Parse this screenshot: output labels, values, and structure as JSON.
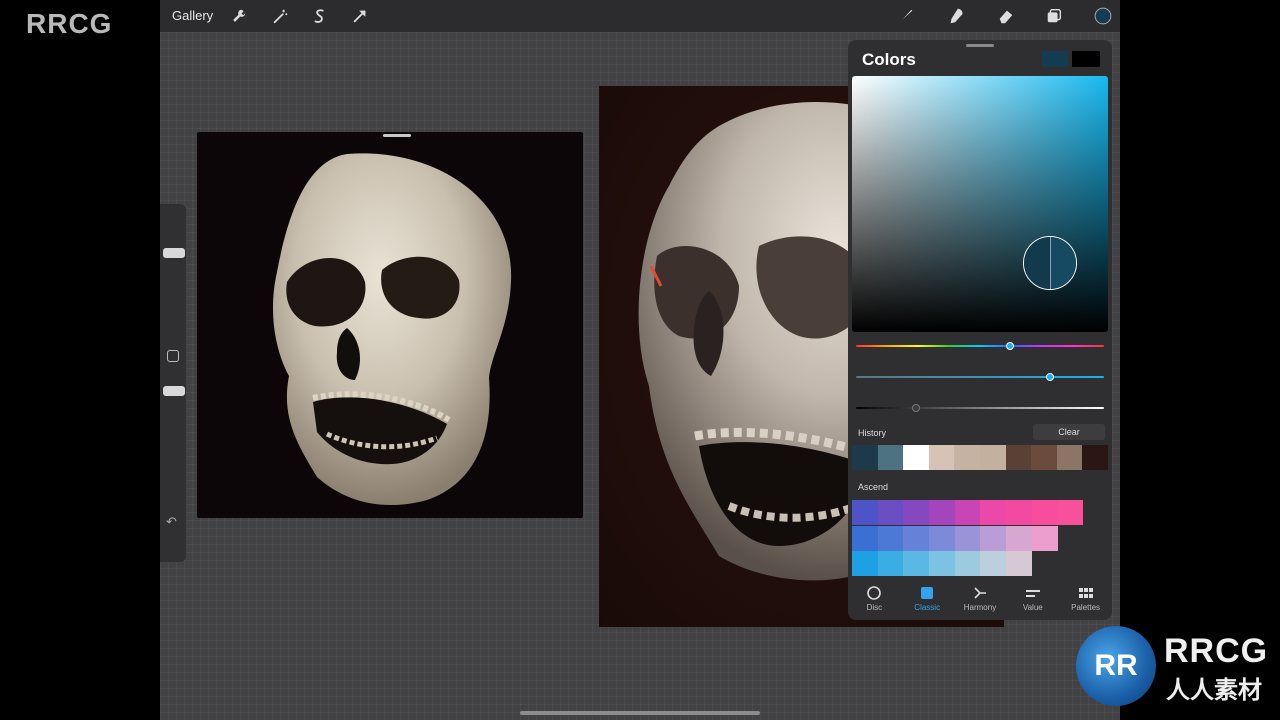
{
  "watermark": {
    "brand": "RRCG",
    "brand_cn": "人人素材"
  },
  "toolbar": {
    "gallery_label": "Gallery",
    "left_tools": [
      "wrench-icon",
      "magic-wand-icon",
      "selection-icon",
      "transform-icon"
    ],
    "right_tools": [
      "brush-icon",
      "smudge-icon",
      "eraser-icon",
      "layers-icon"
    ],
    "current_color": "#123c50"
  },
  "colors_panel": {
    "title": "Colors",
    "primary_color": "#123c50",
    "secondary_color": "#000000",
    "hue_position": 0.62,
    "saturation_position": 0.78,
    "brightness_position": 0.24,
    "history_label": "History",
    "clear_label": "Clear",
    "history": [
      "#1d3a48",
      "#4d7282",
      "#ffffff",
      "#d6c2b6",
      "#c6b2a3",
      "#c4b09f",
      "#5a4035",
      "#6b4b3c",
      "#8a7566",
      "#2a1714"
    ],
    "palette_label": "Ascend",
    "palette_rows": [
      [
        "#4d54c8",
        "#6a4fc4",
        "#8548c0",
        "#a346bd",
        "#c945b4",
        "#ec48a8",
        "#f24aa0",
        "#f74d9c",
        "#f8509a"
      ],
      [
        "#3a6fd4",
        "#4d79d6",
        "#6582d8",
        "#7c8bd9",
        "#9a93d8",
        "#bb9dd6",
        "#d7a7d2",
        "#ec9fcf"
      ],
      [
        "#1ea1e4",
        "#3aaee4",
        "#5ab9e4",
        "#7cc3e3",
        "#9ccbe0",
        "#bbcfdc",
        "#d6c9d3"
      ]
    ],
    "tabs": [
      {
        "label": "Disc",
        "icon": "disc-icon"
      },
      {
        "label": "Classic",
        "icon": "classic-icon"
      },
      {
        "label": "Harmony",
        "icon": "harmony-icon"
      },
      {
        "label": "Value",
        "icon": "value-icon"
      },
      {
        "label": "Palettes",
        "icon": "palettes-icon"
      }
    ],
    "active_tab": "Classic"
  }
}
